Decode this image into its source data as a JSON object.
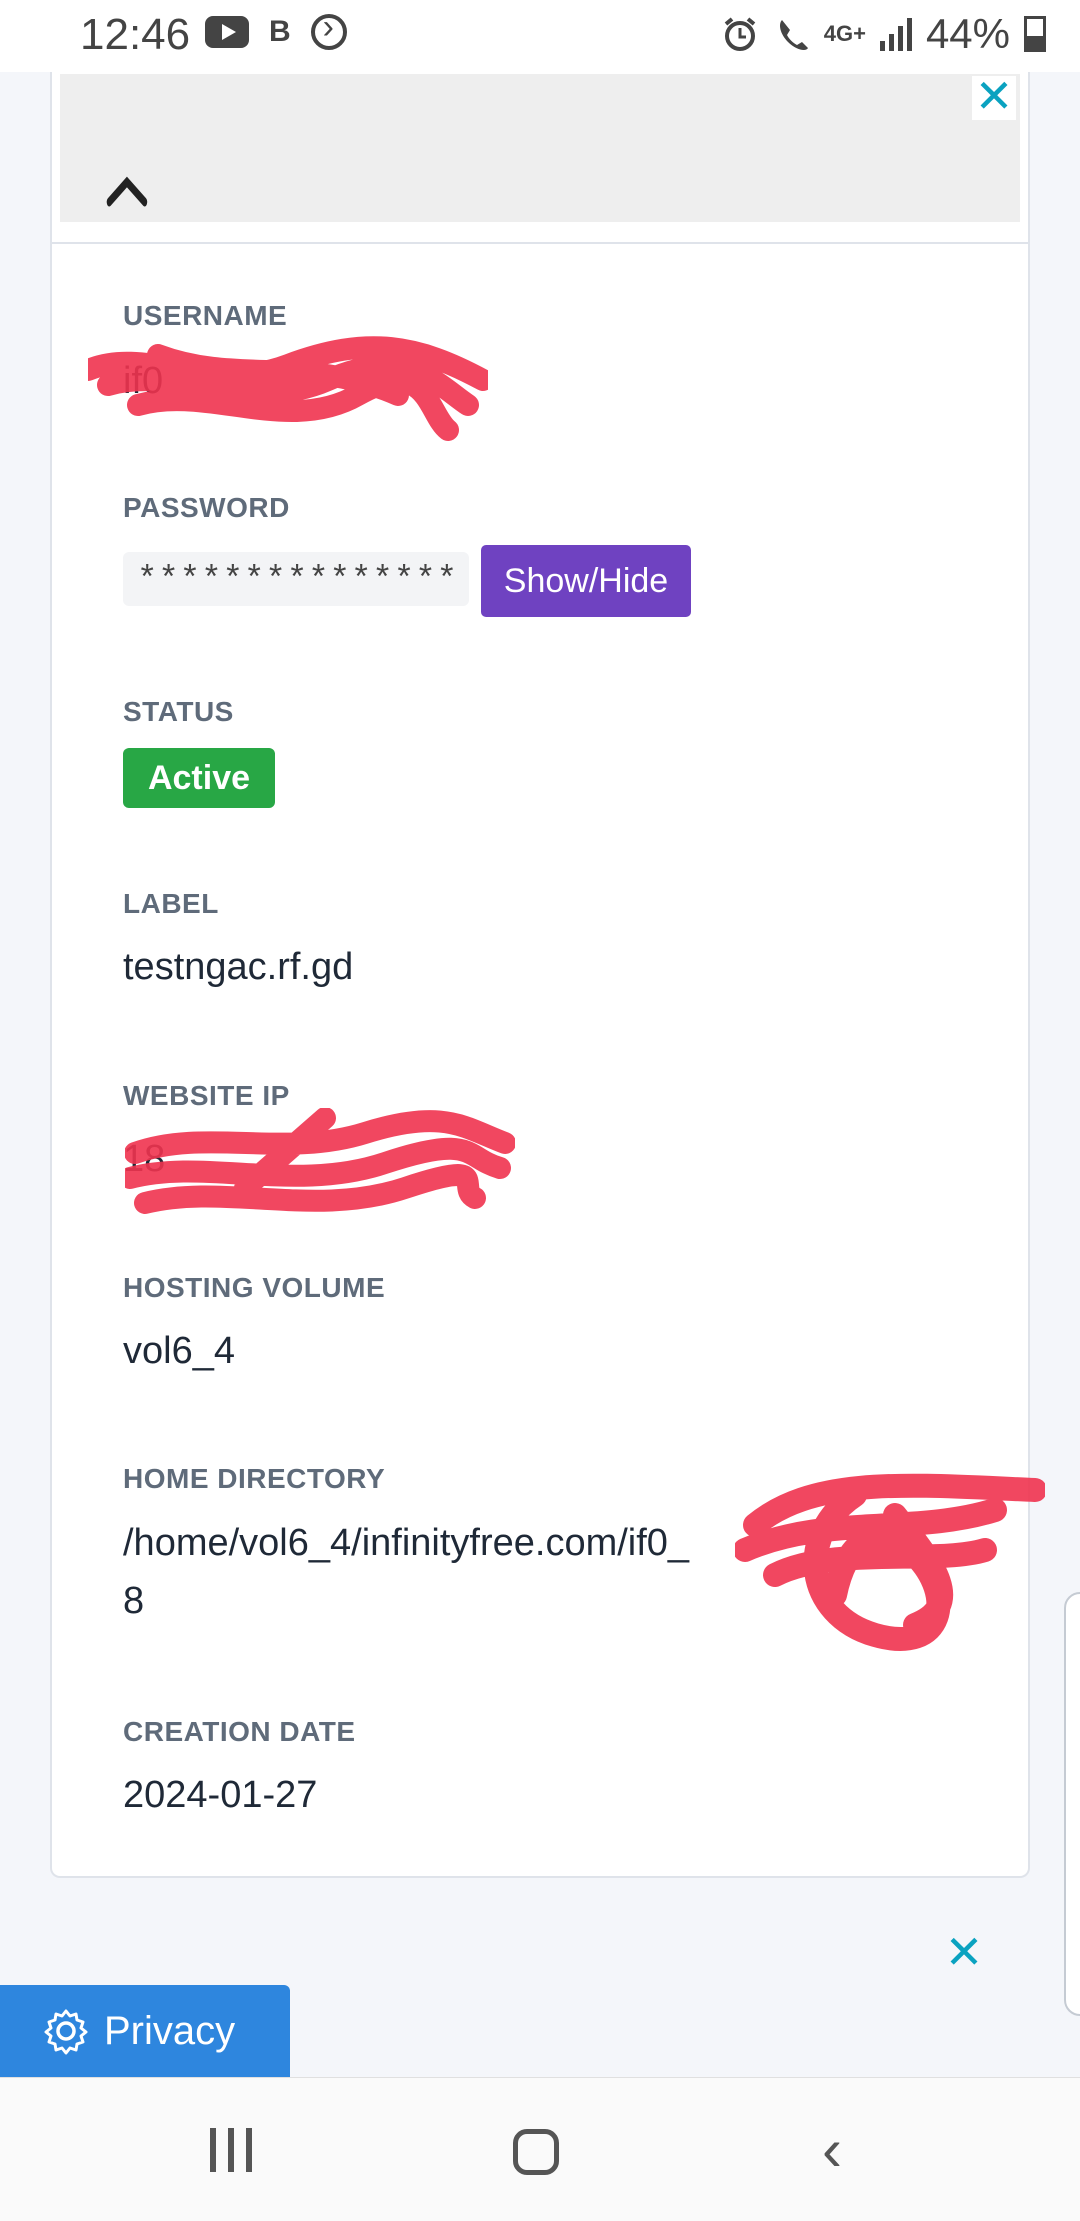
{
  "status_bar": {
    "time": "12:46",
    "network": "4G+",
    "battery": "44%"
  },
  "account": {
    "username_label": "USERNAME",
    "username_value": "if0",
    "password_label": "PASSWORD",
    "password_value": "***************",
    "show_hide_label": "Show/Hide",
    "status_label": "STATUS",
    "status_value": "Active",
    "label_label": "LABEL",
    "label_value": "testngac.rf.gd",
    "website_ip_label": "WEBSITE IP",
    "website_ip_value": "18",
    "hosting_volume_label": "HOSTING VOLUME",
    "hosting_volume_value": "vol6_4",
    "home_directory_label": "HOME DIRECTORY",
    "home_directory_line1": "/home/vol6_4/infinityfree.com/if0_",
    "home_directory_line2": "8",
    "creation_date_label": "CREATION DATE",
    "creation_date_value": "2024-01-27"
  },
  "privacy": {
    "label": "Privacy"
  },
  "colors": {
    "accent_purple": "#6f42c1",
    "status_green": "#28a745",
    "privacy_blue": "#2e86de",
    "close_cyan": "#0aa2c0",
    "redaction_red": "#f0334f"
  }
}
